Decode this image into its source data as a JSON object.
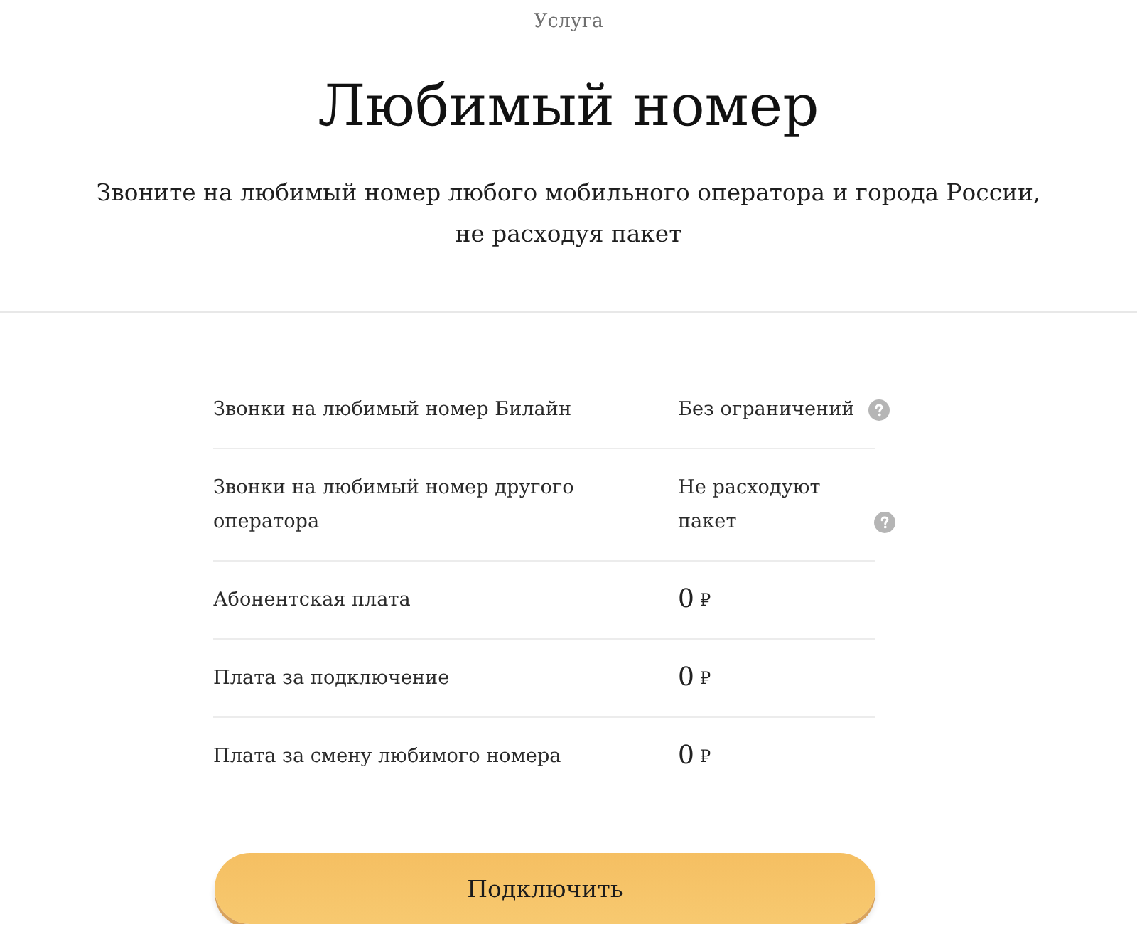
{
  "header": {
    "category": "Услуга",
    "title": "Любимый номер",
    "subtitle": "Звоните на любимый номер любого мобильного оператора и города России, не расходуя пакет"
  },
  "features": [
    {
      "label": "Звонки на любимый номер Билайн",
      "kind": "text",
      "value": "Без ограничений",
      "hint": true
    },
    {
      "label": "Звонки на любимый номер другого оператора",
      "kind": "text",
      "value": "Не расходуют пакет",
      "hint": true
    },
    {
      "label": "Абонентская плата",
      "kind": "price",
      "amount": "0",
      "currency": "₽",
      "hint": false
    },
    {
      "label": "Плата за подключение",
      "kind": "price",
      "amount": "0",
      "currency": "₽",
      "hint": false
    },
    {
      "label": "Плата за смену любимого номера",
      "kind": "price",
      "amount": "0",
      "currency": "₽",
      "hint": false
    }
  ],
  "button": {
    "label": "Подключить"
  }
}
